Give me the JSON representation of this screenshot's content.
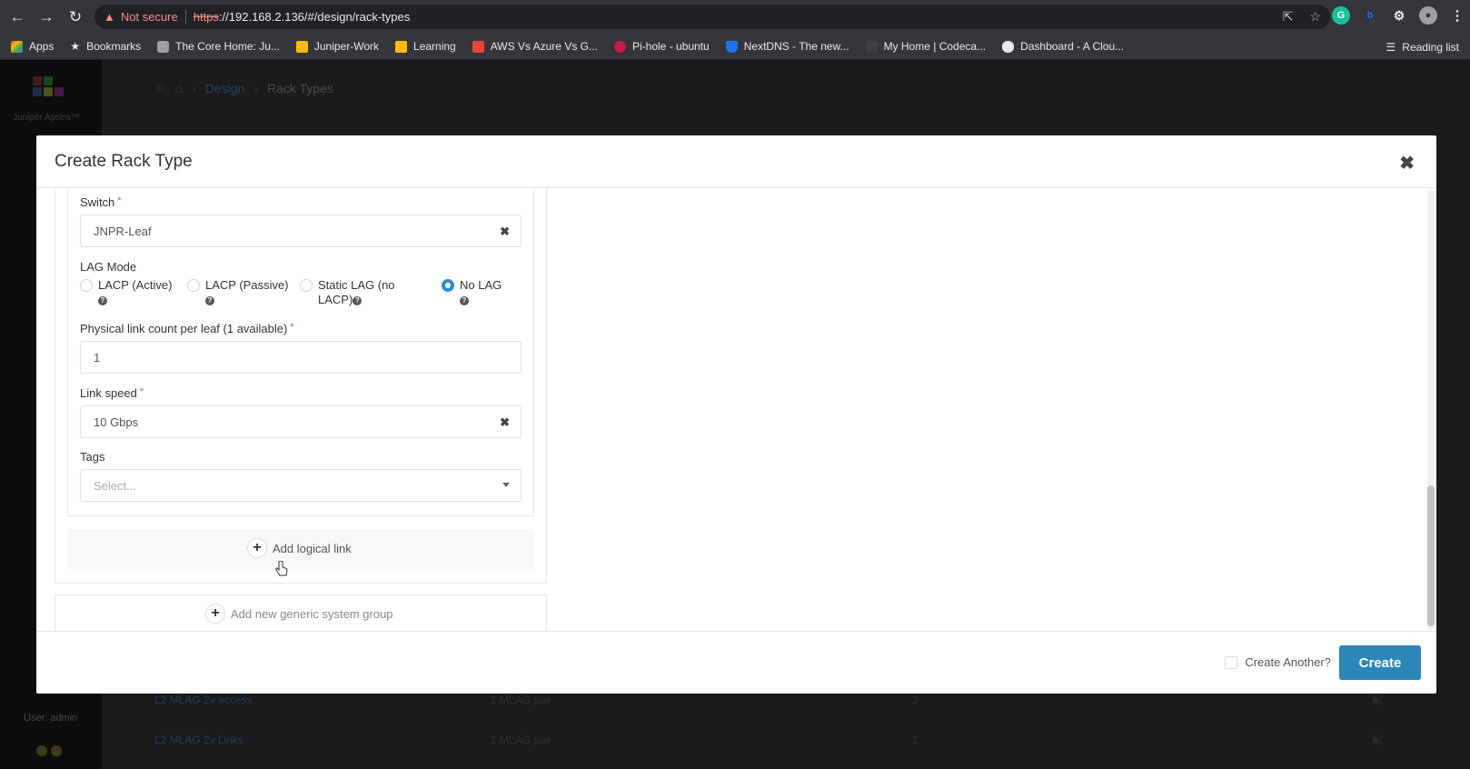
{
  "browser": {
    "not_secure": "Not secure",
    "url_https": "https",
    "url_rest": "://192.168.2.136/#/design/rack-types",
    "bookmarks": [
      {
        "label": "Apps",
        "icon": "apps-grid-icon",
        "color": "#ea4335"
      },
      {
        "label": "Bookmarks",
        "icon": "star-icon",
        "color": "#e8eaed"
      },
      {
        "label": "The Core Home: Ju...",
        "icon": "shield-icon",
        "color": "#9aa0a6"
      },
      {
        "label": "Juniper-Work",
        "icon": "folder-icon",
        "color": "#fbbc04"
      },
      {
        "label": "Learning",
        "icon": "folder-icon",
        "color": "#fbbc04"
      },
      {
        "label": "AWS Vs Azure Vs G...",
        "icon": "aws-logo-icon",
        "color": "#e8433a"
      },
      {
        "label": "Pi-hole - ubuntu",
        "icon": "raspberry-icon",
        "color": "#c51a4a"
      },
      {
        "label": "NextDNS - The new...",
        "icon": "shield-icon",
        "color": "#1a73e8"
      },
      {
        "label": "My Home | Codeca...",
        "icon": "page-icon",
        "color": "#3c4043"
      },
      {
        "label": "Dashboard - A Clou...",
        "icon": "cloud-icon",
        "color": "#e8eaed"
      }
    ],
    "reading_list": "Reading list"
  },
  "app": {
    "logo_text": "Juniper Apstra™",
    "breadcrumb": [
      "Design",
      "Rack Types"
    ],
    "user": "User: admin",
    "bg_rows": [
      {
        "name": "L2 MLAG 2x access",
        "desc": "1 MLAG pair",
        "count": "2"
      },
      {
        "name": "L2 MLAG 2x Links",
        "desc": "1 MLAG pair",
        "count": "1"
      }
    ]
  },
  "modal": {
    "title": "Create Rack Type",
    "switch_label": "Switch",
    "switch_value": "JNPR-Leaf",
    "lag_label": "LAG Mode",
    "lag_options": [
      {
        "line1": "LACP (Active)",
        "line2": "",
        "selected": false
      },
      {
        "line1": "LACP (Passive)",
        "line2": "",
        "selected": false
      },
      {
        "line1": "Static LAG (no",
        "line2": "LACP)",
        "selected": false
      },
      {
        "line1": "No LAG",
        "line2": "",
        "selected": true
      }
    ],
    "link_count_label": "Physical link count per leaf (1 available)",
    "link_count_value": "1",
    "link_speed_label": "Link speed",
    "link_speed_value": "10 Gbps",
    "tags_label": "Tags",
    "tags_placeholder": "Select...",
    "add_logical_link": "Add logical link",
    "add_generic_group": "Add new generic system group",
    "create_another": "Create Another?",
    "create": "Create"
  },
  "colors": {
    "primary": "#2b87b8",
    "radio_selected": "#2a8bd6",
    "required": "#d9534f"
  }
}
